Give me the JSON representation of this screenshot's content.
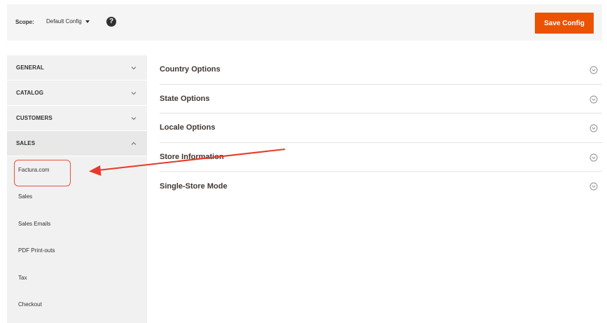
{
  "header": {
    "scope_label": "Scope:",
    "scope_value": "Default Config",
    "help_glyph": "?",
    "save_label": "Save Config",
    "accent_color": "#eb5202"
  },
  "sidebar": {
    "groups": [
      {
        "label": "GENERAL",
        "chevron": "chevron-down-icon"
      },
      {
        "label": "CATALOG",
        "chevron": "chevron-down-icon"
      },
      {
        "label": "CUSTOMERS",
        "chevron": "chevron-down-icon"
      },
      {
        "label": "SALES",
        "chevron": "chevron-up-icon"
      }
    ],
    "sales_items": [
      {
        "label": "Factura.com"
      },
      {
        "label": "Sales"
      },
      {
        "label": "Sales Emails"
      },
      {
        "label": "PDF Print-outs"
      },
      {
        "label": "Tax"
      },
      {
        "label": "Checkout"
      }
    ]
  },
  "main": {
    "sections": [
      {
        "title": "Country Options",
        "icon": "collapse-circle-icon"
      },
      {
        "title": "State Options",
        "icon": "collapse-circle-icon"
      },
      {
        "title": "Locale Options",
        "icon": "collapse-circle-icon"
      },
      {
        "title": "Store Information",
        "icon": "collapse-circle-icon"
      },
      {
        "title": "Single-Store Mode",
        "icon": "collapse-circle-icon"
      }
    ]
  },
  "annotation": {
    "color": "#e8523f"
  }
}
